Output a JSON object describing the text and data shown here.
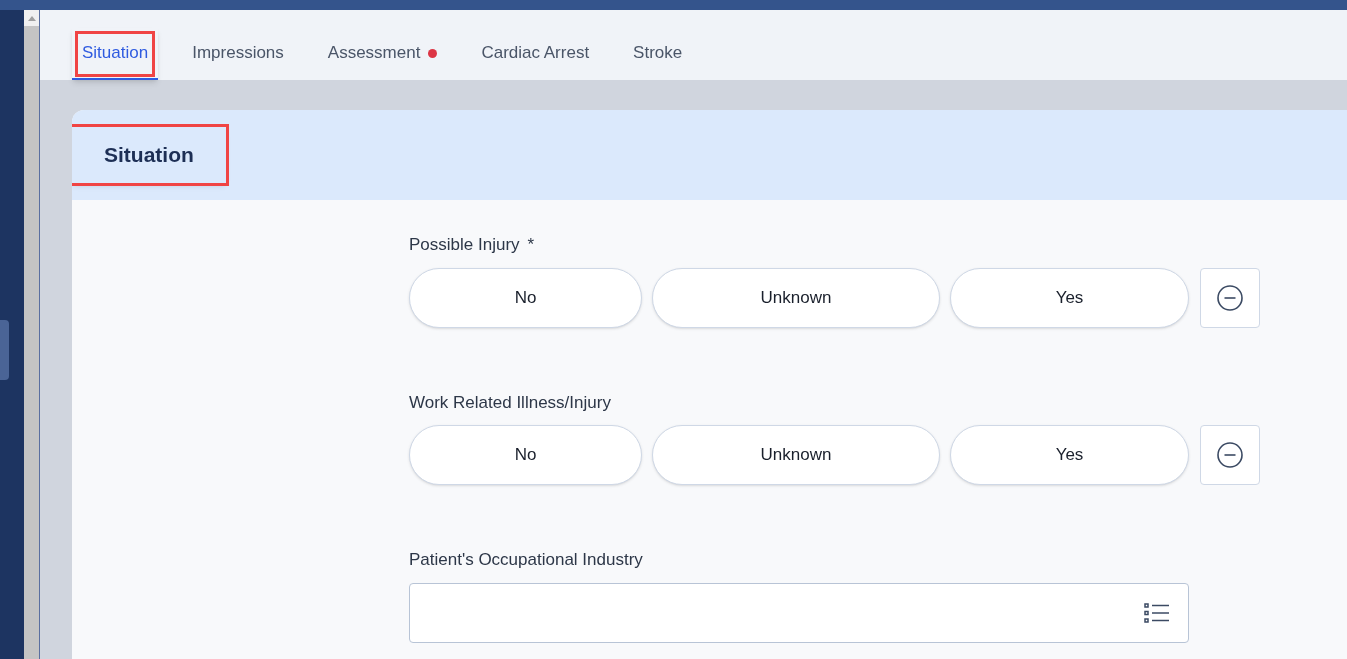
{
  "tabs": [
    {
      "label": "Situation",
      "selected": true,
      "flagged": false,
      "highlighted": true
    },
    {
      "label": "Impressions",
      "selected": false,
      "flagged": false,
      "highlighted": false
    },
    {
      "label": "Assessment",
      "selected": false,
      "flagged": true,
      "highlighted": false
    },
    {
      "label": "Cardiac Arrest",
      "selected": false,
      "flagged": false,
      "highlighted": false
    },
    {
      "label": "Stroke",
      "selected": false,
      "flagged": false,
      "highlighted": false
    }
  ],
  "section": {
    "title": "Situation",
    "highlighted": true
  },
  "fields": [
    {
      "kind": "choice",
      "label": "Possible Injury",
      "required_mark": "*",
      "options": [
        {
          "label": "No",
          "selected": false
        },
        {
          "label": "Unknown",
          "selected": false
        },
        {
          "label": "Yes",
          "selected": false
        }
      ]
    },
    {
      "kind": "choice",
      "label": "Work Related Illness/Injury",
      "options": [
        {
          "label": "No",
          "selected": false
        },
        {
          "label": "Unknown",
          "selected": false
        },
        {
          "label": "Yes",
          "selected": false
        }
      ]
    },
    {
      "kind": "select",
      "label": "Patient's Occupational Industry"
    }
  ]
}
